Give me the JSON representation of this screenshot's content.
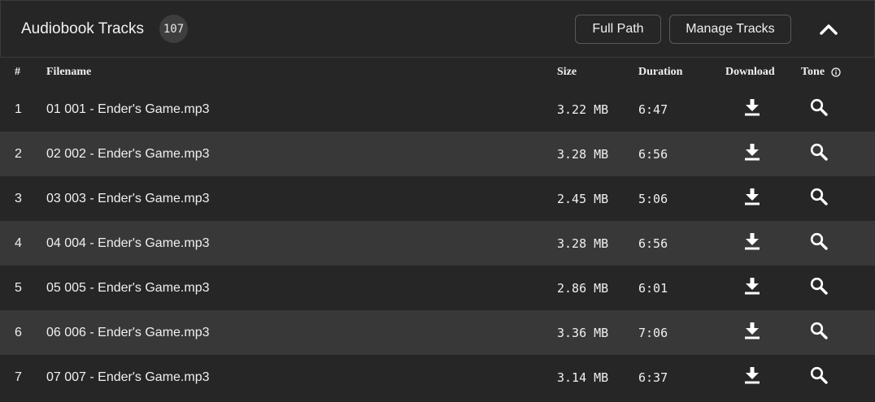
{
  "header": {
    "title": "Audiobook Tracks",
    "count": "107",
    "full_path_label": "Full Path",
    "manage_tracks_label": "Manage Tracks",
    "collapse_icon": "chevron-up-icon"
  },
  "table": {
    "columns": {
      "num": "#",
      "filename": "Filename",
      "size": "Size",
      "duration": "Duration",
      "download": "Download",
      "tone": "Tone"
    },
    "rows": [
      {
        "num": "1",
        "filename": "01 001 - Ender's Game.mp3",
        "size": "3.22 MB",
        "duration": "6:47"
      },
      {
        "num": "2",
        "filename": "02 002 - Ender's Game.mp3",
        "size": "3.28 MB",
        "duration": "6:56"
      },
      {
        "num": "3",
        "filename": "03 003 - Ender's Game.mp3",
        "size": "2.45 MB",
        "duration": "5:06"
      },
      {
        "num": "4",
        "filename": "04 004 - Ender's Game.mp3",
        "size": "3.28 MB",
        "duration": "6:56"
      },
      {
        "num": "5",
        "filename": "05 005 - Ender's Game.mp3",
        "size": "2.86 MB",
        "duration": "6:01"
      },
      {
        "num": "6",
        "filename": "06 006 - Ender's Game.mp3",
        "size": "3.36 MB",
        "duration": "7:06"
      },
      {
        "num": "7",
        "filename": "07 007 - Ender's Game.mp3",
        "size": "3.14 MB",
        "duration": "6:37"
      }
    ]
  },
  "colors": {
    "background": "#262626",
    "row_alt": "#383838",
    "text": "#f0f0f0",
    "button_border": "#5a5a5a"
  },
  "icons": {
    "download": "download-icon",
    "tone": "search-icon",
    "tone_info": "info-icon"
  }
}
